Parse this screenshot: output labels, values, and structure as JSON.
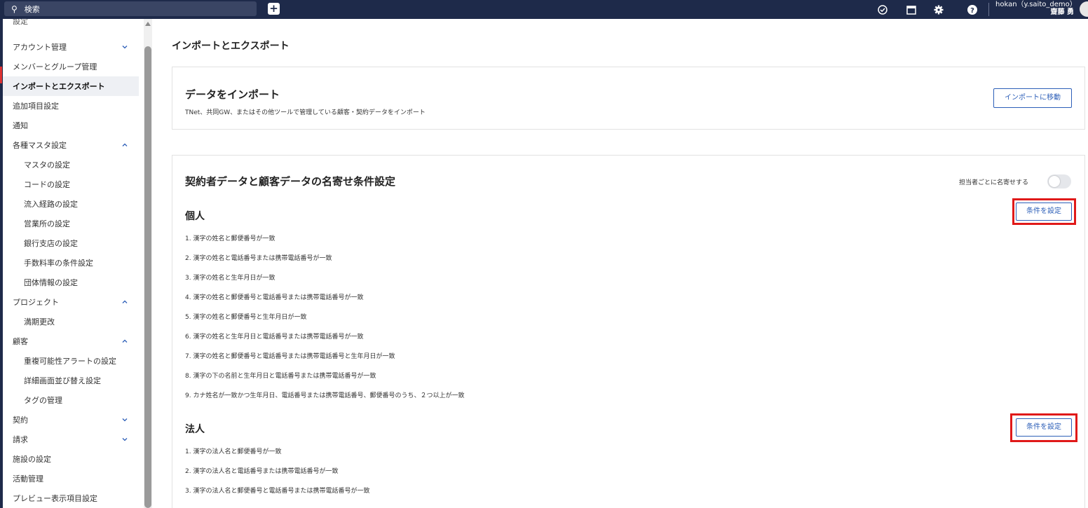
{
  "topbar": {
    "search_placeholder": "検索",
    "user_line1": "hokan（y.saito_demo）",
    "user_line2": "齋藤 勇"
  },
  "sidebar": {
    "partial_top_label": "設定",
    "items": [
      {
        "label": "アカウント管理",
        "chevron": "down"
      },
      {
        "label": "メンバーとグループ管理"
      },
      {
        "label": "インポートとエクスポート",
        "active": true
      },
      {
        "label": "追加項目設定"
      },
      {
        "label": "通知"
      },
      {
        "label": "各種マスタ設定",
        "chevron": "up"
      },
      {
        "label": "マスタの設定",
        "sub": true
      },
      {
        "label": "コードの設定",
        "sub": true
      },
      {
        "label": "流入経路の設定",
        "sub": true
      },
      {
        "label": "営業所の設定",
        "sub": true
      },
      {
        "label": "銀行支店の設定",
        "sub": true
      },
      {
        "label": "手数料率の条件設定",
        "sub": true
      },
      {
        "label": "団体情報の設定",
        "sub": true
      },
      {
        "label": "プロジェクト",
        "chevron": "up"
      },
      {
        "label": "満期更改",
        "sub": true
      },
      {
        "label": "顧客",
        "chevron": "up"
      },
      {
        "label": "重複可能性アラートの設定",
        "sub": true
      },
      {
        "label": "詳細画面並び替え設定",
        "sub": true
      },
      {
        "label": "タグの管理",
        "sub": true
      },
      {
        "label": "契約",
        "chevron": "down"
      },
      {
        "label": "請求",
        "chevron": "down"
      },
      {
        "label": "施設の設定"
      },
      {
        "label": "活動管理"
      },
      {
        "label": "プレビュー表示項目設定"
      }
    ]
  },
  "main": {
    "page_title": "インポートとエクスポート",
    "import_card": {
      "title": "データをインポート",
      "description": "TNet、共同GW、またはその他ツールで管理している顧客・契約データをインポート",
      "button": "インポートに移動"
    },
    "match_card": {
      "title": "契約者データと顧客データの名寄せ条件設定",
      "toggle_label": "担当者ごとに名寄せする",
      "toggle_on": false,
      "individual": {
        "title": "個人",
        "button": "条件を設定",
        "rules": [
          "1. 漢字の姓名と郵便番号が一致",
          "2. 漢字の姓名と電話番号または携帯電話番号が一致",
          "3. 漢字の姓名と生年月日が一致",
          "4. 漢字の姓名と郵便番号と電話番号または携帯電話番号が一致",
          "5. 漢字の姓名と郵便番号と生年月日が一致",
          "6. 漢字の姓名と生年月日と電話番号または携帯電話番号が一致",
          "7. 漢字の姓名と郵便番号と電話番号または携帯電話番号と生年月日が一致",
          "8. 漢字の下の名前と生年月日と電話番号または携帯電話番号が一致",
          "9. カナ姓名が一致かつ生年月日、電話番号または携帯電話番号、郵便番号のうち、２つ以上が一致"
        ]
      },
      "corporate": {
        "title": "法人",
        "button": "条件を設定",
        "rules": [
          "1. 漢字の法人名と郵便番号が一致",
          "2. 漢字の法人名と電話番号または携帯電話番号が一致",
          "3. 漢字の法人名と郵便番号と電話番号または携帯電話番号が一致"
        ]
      }
    }
  },
  "colors": {
    "topbar": "#1e2a4a",
    "accent": "#2d5fb8",
    "highlight": "#e01919"
  }
}
